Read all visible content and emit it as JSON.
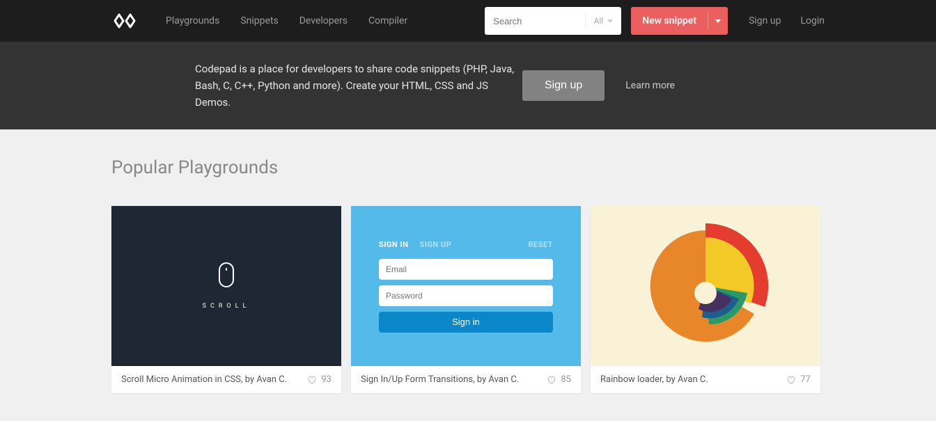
{
  "nav": {
    "playgrounds": "Playgrounds",
    "snippets": "Snippets",
    "developers": "Developers",
    "compiler": "Compiler"
  },
  "search": {
    "placeholder": "Search",
    "filter": "All"
  },
  "new_snippet": "New snippet",
  "auth": {
    "signup": "Sign up",
    "login": "Login"
  },
  "hero": {
    "text": "Codepad is a place for developers to share code snippets (PHP, Java, Bash, C, C++, Python and more). Create your HTML, CSS and JS Demos.",
    "signup": "Sign up",
    "learn": "Learn more"
  },
  "section_title": "Popular Playgrounds",
  "cards": [
    {
      "title": "Scroll Micro Animation in CSS, by Avan C.",
      "likes": "93",
      "preview": {
        "scroll_label": "Scroll"
      }
    },
    {
      "title": "Sign In/Up Form Transitions, by Avan C.",
      "likes": "85",
      "preview": {
        "signin": "SIGN IN",
        "signup": "SIGN UP",
        "reset": "RESET",
        "email_ph": "Email",
        "pass_ph": "Password",
        "btn": "Sign in"
      }
    },
    {
      "title": "Rainbow loader, by Avan C.",
      "likes": "77"
    }
  ]
}
